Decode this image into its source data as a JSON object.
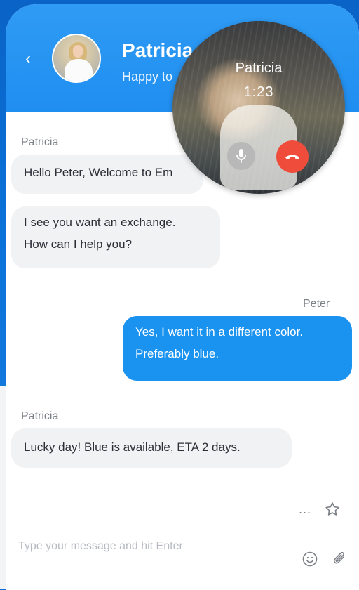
{
  "header": {
    "name": "Patricia",
    "status": "Happy to"
  },
  "call": {
    "name": "Patricia",
    "timer": "1:23"
  },
  "messages": [
    {
      "sender": "Patricia",
      "text": "Hello Peter, Welcome to Em"
    },
    {
      "text": "I see you want an exchange."
    },
    {
      "text": "How can I help you?"
    },
    {
      "sender": "Peter",
      "text": "Yes, I want it in a different color."
    },
    {
      "text": "Preferably blue."
    },
    {
      "sender": "Patricia",
      "text": "Lucky day! Blue is available, ETA 2 days."
    }
  ],
  "composer": {
    "placeholder": "Type your message and hit Enter",
    "more_label": "..."
  },
  "colors": {
    "primary": "#1a92f0",
    "end_call": "#ef4c3b"
  }
}
